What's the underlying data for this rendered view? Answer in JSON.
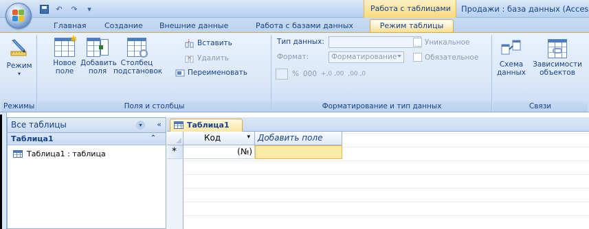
{
  "titlebar": {
    "context_tab": "Работа с таблицами",
    "app_title": "Продажи : база данных (Access"
  },
  "tabs": [
    {
      "label": "Главная"
    },
    {
      "label": "Создание"
    },
    {
      "label": "Внешние данные"
    },
    {
      "label": "Работа с базами данных"
    },
    {
      "label": "Режим таблицы",
      "active": true
    }
  ],
  "ribbon": {
    "views": {
      "group_label": "Режимы",
      "mode_button": "Режим"
    },
    "fields": {
      "group_label": "Поля и столбцы",
      "new_field_1": "Новое",
      "new_field_2": "поле",
      "add_fields_1": "Добавить",
      "add_fields_2": "поля",
      "lookup_1": "Столбец",
      "lookup_2": "подстановок",
      "insert": "Вставить",
      "delete": "Удалить",
      "rename": "Переименовать"
    },
    "formatting": {
      "group_label": "Форматирование и тип данных",
      "data_type_label": "Тип данных:",
      "data_type_value": "",
      "format_label": "Формат:",
      "format_value": "Форматирование",
      "unique": "Уникальное",
      "required": "Обязательное",
      "percent": "%",
      "thousands": "000",
      "inc_decimal": "+,0 ,00",
      "dec_decimal": ",00 ,0"
    },
    "relationships": {
      "group_label": "Связи",
      "schema_1": "Схема",
      "schema_2": "данных",
      "deps_1": "Зависимости",
      "deps_2": "объектов"
    }
  },
  "navpane": {
    "header": "Все таблицы",
    "group": "Таблица1",
    "items": [
      {
        "label": "Таблица1 : таблица"
      }
    ]
  },
  "document": {
    "tab_label": "Таблица1",
    "columns": [
      {
        "label": "Код"
      },
      {
        "label": "Добавить поле"
      }
    ],
    "new_row_marker": "*",
    "new_row_value": "(№)"
  },
  "colors": {
    "accent_tab": "#f8df92",
    "ribbon_text": "#15428b",
    "selected_cell": "#fbe9a6"
  }
}
